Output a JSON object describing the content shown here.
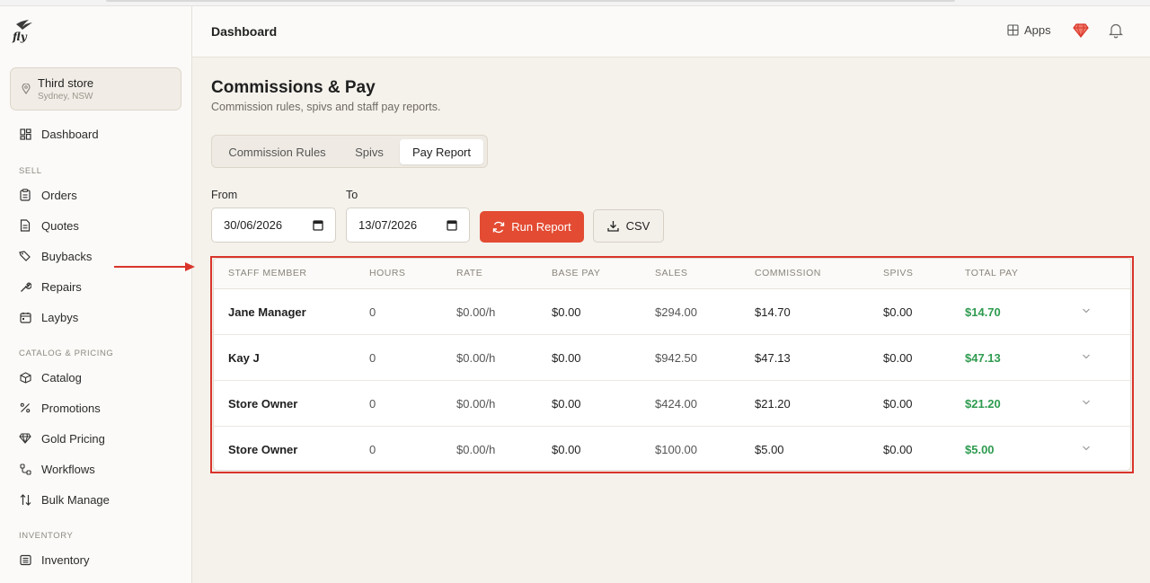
{
  "brand": {
    "logo_text": "fly"
  },
  "store": {
    "name": "Third store",
    "location": "Sydney, NSW"
  },
  "sidebar": {
    "dashboard": "Dashboard",
    "sections": {
      "sell": "SELL",
      "catalog": "CATALOG & PRICING",
      "inventory": "INVENTORY"
    },
    "items": {
      "orders": "Orders",
      "quotes": "Quotes",
      "buybacks": "Buybacks",
      "repairs": "Repairs",
      "laybys": "Laybys",
      "catalog": "Catalog",
      "promotions": "Promotions",
      "gold_pricing": "Gold Pricing",
      "workflows": "Workflows",
      "bulk_manage": "Bulk Manage",
      "inventory": "Inventory"
    }
  },
  "header": {
    "title": "Dashboard",
    "apps_label": "Apps"
  },
  "page": {
    "title": "Commissions & Pay",
    "subtitle": "Commission rules, spivs and staff pay reports."
  },
  "tabs": {
    "commission_rules": "Commission Rules",
    "spivs": "Spivs",
    "pay_report": "Pay Report"
  },
  "filters": {
    "from_label": "From",
    "to_label": "To",
    "from_value": "30/06/2026",
    "to_value": "13/07/2026",
    "run_label": "Run Report",
    "csv_label": "CSV"
  },
  "table": {
    "headers": {
      "staff": "STAFF MEMBER",
      "hours": "HOURS",
      "rate": "RATE",
      "base_pay": "BASE PAY",
      "sales": "SALES",
      "commission": "COMMISSION",
      "spivs": "SPIVS",
      "total_pay": "TOTAL PAY"
    },
    "rows": [
      {
        "staff": "Jane Manager",
        "hours": "0",
        "rate": "$0.00/h",
        "base_pay": "$0.00",
        "sales": "$294.00",
        "commission": "$14.70",
        "spivs": "$0.00",
        "total_pay": "$14.70"
      },
      {
        "staff": "Kay J",
        "hours": "0",
        "rate": "$0.00/h",
        "base_pay": "$0.00",
        "sales": "$942.50",
        "commission": "$47.13",
        "spivs": "$0.00",
        "total_pay": "$47.13"
      },
      {
        "staff": "Store Owner",
        "hours": "0",
        "rate": "$0.00/h",
        "base_pay": "$0.00",
        "sales": "$424.00",
        "commission": "$21.20",
        "spivs": "$0.00",
        "total_pay": "$21.20"
      },
      {
        "staff": "Store Owner",
        "hours": "0",
        "rate": "$0.00/h",
        "base_pay": "$0.00",
        "sales": "$100.00",
        "commission": "$5.00",
        "spivs": "$0.00",
        "total_pay": "$5.00"
      }
    ]
  },
  "colors": {
    "accent": "#e34b32",
    "total_green": "#2e9b4f",
    "highlight": "#d9352b"
  }
}
